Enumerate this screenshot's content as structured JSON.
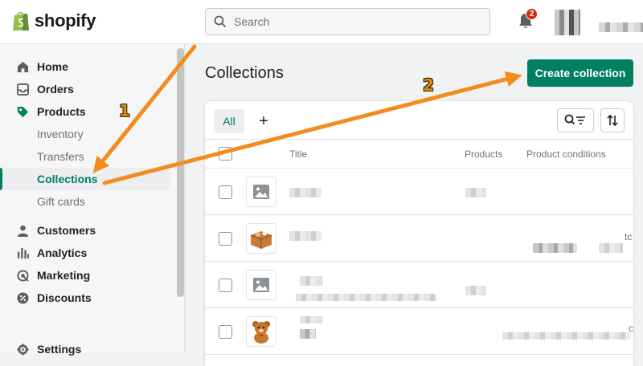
{
  "app": {
    "logo_text": "shopify",
    "brand_color": "#008060"
  },
  "topbar": {
    "search_placeholder": "Search",
    "notification_count": "2"
  },
  "sidebar": {
    "items": [
      {
        "label": "Home",
        "icon": "home-icon"
      },
      {
        "label": "Orders",
        "icon": "orders-icon"
      },
      {
        "label": "Products",
        "icon": "tag-icon"
      },
      {
        "label": "Inventory"
      },
      {
        "label": "Transfers"
      },
      {
        "label": "Collections",
        "active": true
      },
      {
        "label": "Gift cards"
      },
      {
        "label": "Customers",
        "icon": "person-icon"
      },
      {
        "label": "Analytics",
        "icon": "bar-chart-icon"
      },
      {
        "label": "Marketing",
        "icon": "target-icon"
      },
      {
        "label": "Discounts",
        "icon": "discount-icon"
      },
      {
        "label": "Settings",
        "icon": "gear-icon"
      }
    ]
  },
  "main": {
    "title": "Collections",
    "create_button": "Create collection",
    "tabs": [
      {
        "label": "All"
      }
    ],
    "add_tab": "+",
    "columns": [
      "Title",
      "Products",
      "Product conditions"
    ],
    "rows": [
      {
        "thumb": "placeholder-image-icon",
        "partial_text": ""
      },
      {
        "thumb": "box-product-icon",
        "partial_text": "tc"
      },
      {
        "thumb": "placeholder-image-icon",
        "partial_text": ""
      },
      {
        "thumb": "teddy-bear-product-icon",
        "partial_text": "c"
      }
    ]
  },
  "annotations": {
    "step1": "1",
    "step2": "2",
    "arrow_color": "#f28c1f"
  }
}
